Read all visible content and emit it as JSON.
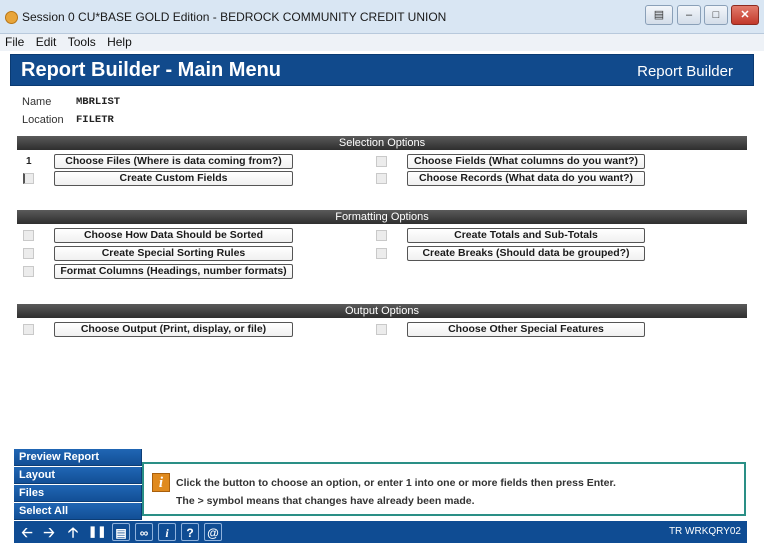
{
  "window": {
    "title": "Session 0 CU*BASE GOLD Edition - BEDROCK COMMUNITY CREDIT UNION",
    "controls": [
      "restore-icon",
      "minimize-icon",
      "maximize-icon",
      "close-icon"
    ]
  },
  "menu": [
    "File",
    "Edit",
    "Tools",
    "Help"
  ],
  "header": {
    "title": "Report Builder - Main Menu",
    "right": "Report Builder"
  },
  "fields": {
    "name_label": "Name",
    "name_value": "MBRLIST",
    "location_label": "Location",
    "location_value": "FILETR"
  },
  "sections": {
    "selection": {
      "title": "Selection Options",
      "left": [
        {
          "value": "1",
          "label": "Choose Files (Where is data coming from?)"
        },
        {
          "value": "",
          "label": "Create Custom Fields"
        }
      ],
      "right": [
        {
          "value": "",
          "label": "Choose Fields (What columns do you want?)"
        },
        {
          "value": "",
          "label": "Choose Records (What data do you want?)"
        }
      ]
    },
    "formatting": {
      "title": "Formatting Options",
      "left": [
        {
          "value": "",
          "label": "Choose How Data Should be Sorted"
        },
        {
          "value": "",
          "label": "Create Special Sorting Rules"
        },
        {
          "value": "",
          "label": "Format Columns (Headings, number formats)"
        }
      ],
      "right": [
        {
          "value": "",
          "label": "Create Totals and Sub-Totals"
        },
        {
          "value": "",
          "label": "Create Breaks (Should data be grouped?)"
        }
      ]
    },
    "output": {
      "title": "Output Options",
      "left": [
        {
          "value": "",
          "label": "Choose Output (Print, display, or file)"
        }
      ],
      "right": [
        {
          "value": "",
          "label": "Choose Other Special Features"
        }
      ]
    }
  },
  "side_buttons": [
    "Preview Report",
    "Layout",
    "Files",
    "Select All"
  ],
  "message": {
    "line1": "Click the button to choose an option, or enter 1 into one or more fields then press Enter.",
    "line2": "The > symbol means that changes have already been made."
  },
  "toolbar": {
    "icons": [
      "back-arrow-icon",
      "forward-arrow-icon",
      "up-arrow-icon",
      "pause-icon",
      "print-icon",
      "link-icon",
      "info-icon",
      "help-icon",
      "at-icon"
    ],
    "code": "TR WRKQRY02"
  }
}
